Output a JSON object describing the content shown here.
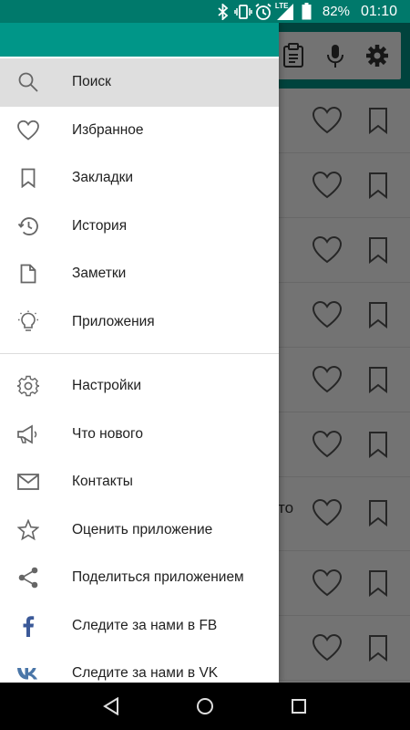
{
  "status_bar": {
    "network_label": "LTE",
    "battery": "82%",
    "time": "01:10",
    "icons": [
      "bluetooth-icon",
      "vibrate-icon",
      "alarm-icon",
      "signal-icon",
      "battery-icon"
    ]
  },
  "drawer": {
    "items_primary": [
      {
        "label": "Поиск",
        "icon": "search-icon",
        "active": true
      },
      {
        "label": "Избранное",
        "icon": "heart-icon"
      },
      {
        "label": "Закладки",
        "icon": "bookmark-icon"
      },
      {
        "label": "История",
        "icon": "history-icon"
      },
      {
        "label": "Заметки",
        "icon": "note-icon"
      },
      {
        "label": "Приложения",
        "icon": "lightbulb-icon"
      }
    ],
    "items_secondary": [
      {
        "label": "Настройки",
        "icon": "gear-icon"
      },
      {
        "label": "Что нового",
        "icon": "megaphone-icon"
      },
      {
        "label": "Контакты",
        "icon": "mail-icon"
      },
      {
        "label": "Оценить приложение",
        "icon": "star-icon"
      },
      {
        "label": "Поделиться приложением",
        "icon": "share-icon"
      },
      {
        "label": "Следите за нами в FB",
        "icon": "facebook-icon"
      },
      {
        "label": "Следите за нами в VK",
        "icon": "vk-icon"
      }
    ]
  },
  "background": {
    "toolbar_icons": [
      "clipboard-icon",
      "microphone-icon",
      "gear-icon"
    ],
    "row_fragment": "то",
    "row_count": 9
  },
  "colors": {
    "status_bar": "#00796b",
    "primary": "#009688",
    "active_item": "#dedede",
    "facebook": "#3b5998",
    "vk": "#4a76a8"
  },
  "nav_bar": [
    "back-icon",
    "home-icon",
    "recents-icon"
  ]
}
